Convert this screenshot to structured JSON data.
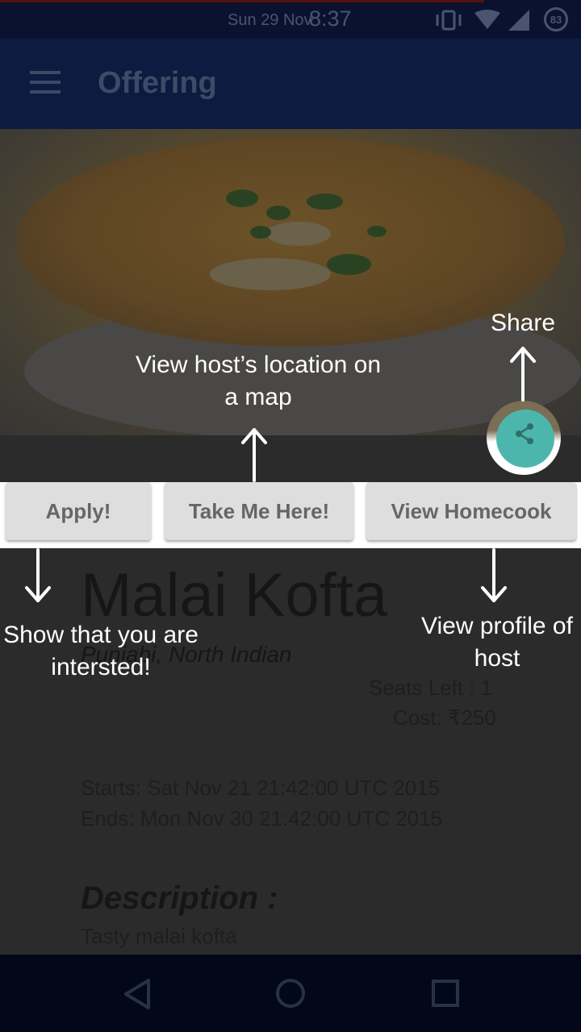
{
  "status_bar": {
    "date": "Sun 29 Nov",
    "time": "8:37",
    "battery_level": "83",
    "icons": [
      "vibrate-icon",
      "wifi-icon",
      "signal-icon",
      "battery-icon"
    ]
  },
  "app_bar": {
    "title": "Offering",
    "menu_icon": "hamburger-menu-icon"
  },
  "actions": {
    "apply_label": "Apply!",
    "take_me_here_label": "Take Me Here!",
    "view_homecook_label": "View Homecook",
    "share_icon": "share-icon"
  },
  "offering": {
    "name": "Malai Kofta",
    "cuisine": "Punjabi, North Indian",
    "seats_left": "Seats Left : 1",
    "cost": "Cost: ₹250",
    "starts": "Starts: Sat Nov 21 21:42:00 UTC 2015",
    "ends": "Ends: Mon Nov 30 21:42:00 UTC 2015",
    "description_heading": "Description :",
    "description": "Tasty malai kofta"
  },
  "coach_marks": {
    "share": "Share",
    "location_line1": "View host’s location on",
    "location_line2": "a map",
    "apply_line1": "Show that you are",
    "apply_line2": "intersted!",
    "profile_line1": "View profile of",
    "profile_line2": "host"
  },
  "nav_bar": {
    "back_icon": "back-icon",
    "home_icon": "home-icon",
    "recents_icon": "recents-icon"
  },
  "colors": {
    "accent": "#4db6ac",
    "app_bar": "#0d1b40",
    "overlay_text": "#ffffff"
  }
}
